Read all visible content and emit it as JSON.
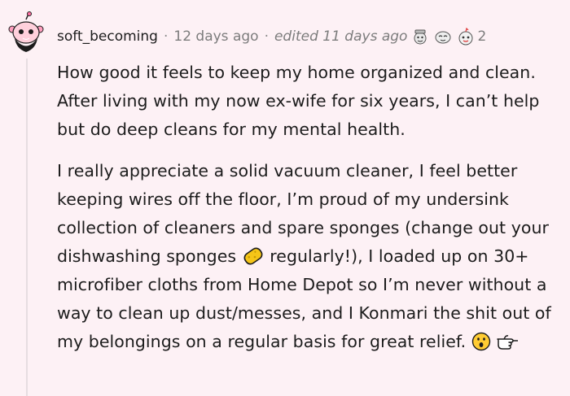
{
  "comment": {
    "username": "soft_becoming",
    "separator": "·",
    "posted_ago": "12 days ago",
    "edited_text": "edited 11 days ago",
    "award_count": "2",
    "paragraph1": "How good it feels to keep my home organized and clean. After living with my now ex-wife for six years, I can’t help but do deep cleans for my mental health.",
    "paragraph2_part1": "I really appreciate a solid vacuum cleaner, I feel better keeping wires off the floor, I’m proud of my undersink collection of cleaners and spare sponges (change out your dishwashing sponges",
    "paragraph2_part2": "regularly!), I loaded up on 30+ microfiber cloths from Home Depot so I’m never without a way to clean up dust/messes, and I Konmari the shit out of my belongings on a regular basis for great relief.",
    "icons": [
      "reddit-avatar-icon",
      "award-icon-1",
      "award-icon-2",
      "award-icon-3",
      "sponge-emoji-icon",
      "surprised-emoji-icon",
      "pointing-hand-emoji-icon"
    ]
  },
  "colors": {
    "background": "#fdf1f5",
    "text": "#1c1c1c",
    "meta": "#7c7c7c",
    "thread_line": "#e6dde1",
    "sponge": "#f5c518",
    "emoji_face": "#ffcc33"
  }
}
